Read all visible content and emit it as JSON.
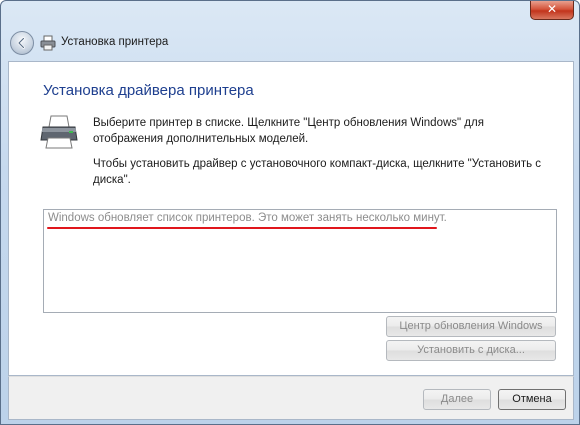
{
  "window": {
    "close_label": "✕"
  },
  "nav": {
    "title": "Установка принтера"
  },
  "main": {
    "heading": "Установка драйвера принтера",
    "paragraph1": "Выберите принтер в списке. Щелкните \"Центр обновления Windows\" для отображения дополнительных моделей.",
    "paragraph2": "Чтобы установить драйвер с установочного компакт-диска, щелкните \"Установить с диска\"."
  },
  "list": {
    "status_text": "Windows обновляет список принтеров. Это может занять несколько минут."
  },
  "buttons": {
    "windows_update": "Центр обновления Windows",
    "have_disk": "Установить с диска...",
    "next": "Далее",
    "cancel": "Отмена"
  },
  "icons": {
    "back": "back-arrow-icon",
    "printer": "printer-icon",
    "close": "close-icon"
  },
  "colors": {
    "heading": "#1e3f8f",
    "close_button": "#c2341c",
    "annotation_underline": "#e0161c",
    "disabled_text": "#8a8a8a"
  }
}
